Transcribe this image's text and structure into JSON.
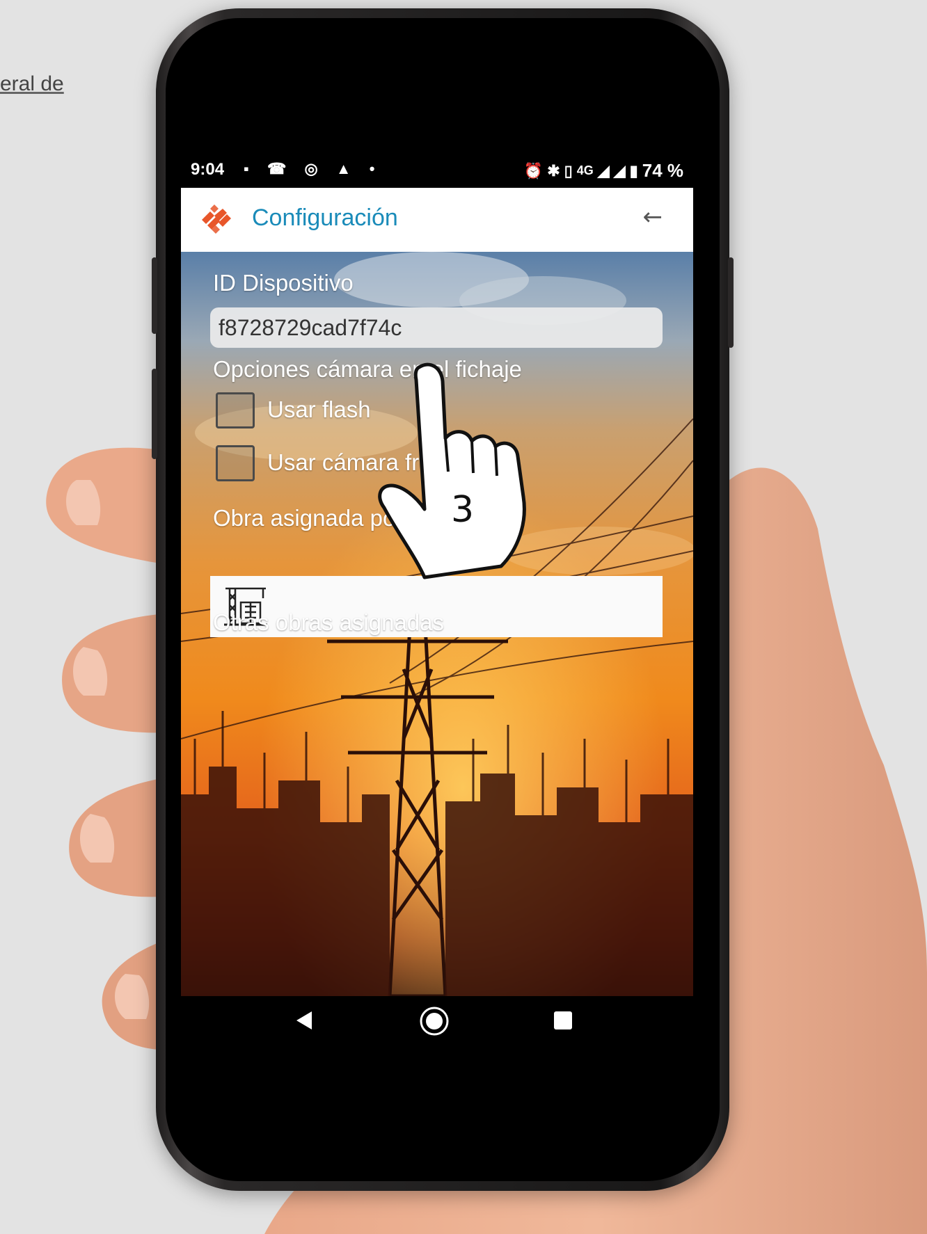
{
  "background": {
    "link_text": "eral de"
  },
  "status_bar": {
    "time": "9:04",
    "network": "4G",
    "battery": "74 %",
    "left_icons": [
      "image-icon",
      "missed-call-icon",
      "sync-icon",
      "drive-icon",
      "dot-icon"
    ],
    "right_icons": [
      "alarm-icon",
      "bluetooth-icon",
      "vibrate-icon",
      "data-icon",
      "signal-icon",
      "signal-icon",
      "battery-icon"
    ]
  },
  "app_bar": {
    "title": "Configuración",
    "back_icon": "arrow-left-icon",
    "accent": "#1a8bb9",
    "logo_color": "#e8562a"
  },
  "form": {
    "device_id_label": "ID Dispositivo",
    "device_id_value": "f8728729cad7f74c",
    "camera_options_label": "Opciones cámara en el fichaje",
    "flash_label": "Usar flash",
    "flash_checked": false,
    "camera_label": "Usar cámara frontal",
    "camera_checked": false,
    "default_obra_label": "Obra asignada por defecto",
    "default_obra_icon": "crane-building-icon",
    "other_obras_label": "Otras obras asignadas"
  },
  "overlay": {
    "step_number": "3",
    "icon": "hand-pointer-icon"
  },
  "nav_bar": {
    "back": "back-triangle-icon",
    "home": "home-circle-icon",
    "recents": "recents-square-icon"
  }
}
